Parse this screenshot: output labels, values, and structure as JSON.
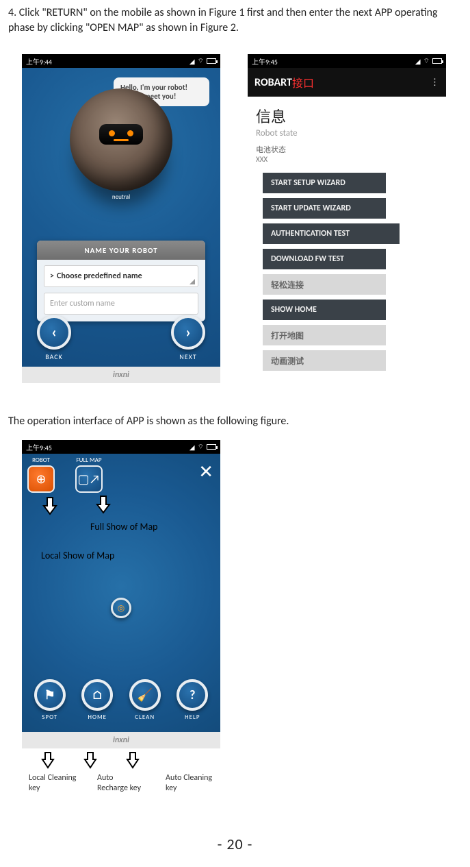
{
  "instruction": "4. Click \"RETURN\" on the mobile as shown in Figure 1 first and then enter the next APP operating phase by clicking \"OPEN MAP\" as shown in Figure 2.",
  "caption_mid": "The operation interface of APP is shown as the following figure.",
  "page_number": "- 20 -",
  "fig1": {
    "time": "上午9:44",
    "bubble": "Hello, I'm your robot! Nice to meet you!",
    "mood": "neutral",
    "card_title": "NAME YOUR ROBOT",
    "row_label_prefix": ">",
    "row_label": "Choose predefined name",
    "placeholder": "Enter custom name",
    "back": "BACK",
    "next": "NEXT",
    "brand": "inxni"
  },
  "fig2": {
    "time": "上午9:45",
    "title_en": "ROBART",
    "title_cn": "接口",
    "info": "信息",
    "sub1": "Robot state",
    "sub2": "电池状态",
    "sub3": "XXX",
    "buttons": [
      {
        "label": "START SETUP WIZARD",
        "style": "dark"
      },
      {
        "label": "START UPDATE WIZARD",
        "style": "dark"
      },
      {
        "label": "AUTHENTICATION TEST",
        "style": "dark wide"
      },
      {
        "label": "DOWNLOAD FW TEST",
        "style": "dark"
      },
      {
        "label": "轻松连接",
        "style": "grey"
      },
      {
        "label": "SHOW HOME",
        "style": "dark"
      },
      {
        "label": "打开地图",
        "style": "grey"
      },
      {
        "label": "动画测试",
        "style": "grey"
      }
    ]
  },
  "fig3": {
    "time": "上午9:45",
    "tab_robot": "ROBOT",
    "tab_fullmap": "FULL MAP",
    "overlay_full": "Full Show of Map",
    "overlay_local": "Local Show of Map",
    "bot": {
      "spot": "SPOT",
      "home": "HOME",
      "clean": "CLEAN",
      "help": "HELP"
    },
    "brand": "inxni",
    "keys": {
      "local": "Local Cleaning key",
      "recharge": "Auto Recharge key",
      "clean": "Auto Cleaning key"
    }
  }
}
